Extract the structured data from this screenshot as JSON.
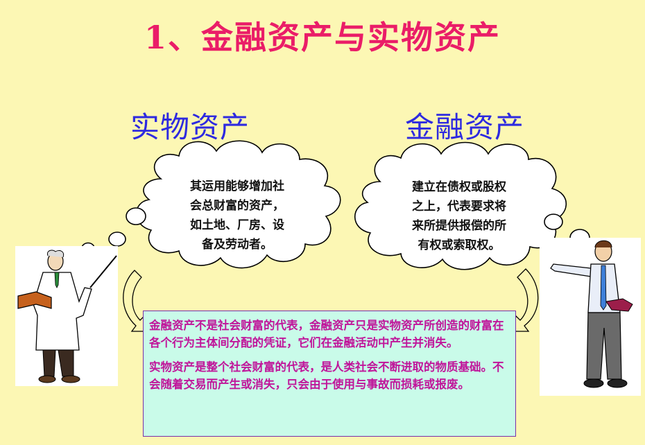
{
  "title": "1、金融资产与实物资产",
  "left_heading": "实物资产",
  "right_heading": "金融资产",
  "left_cloud": {
    "lines": [
      "其运用能够增加社",
      "会总财富的资产，",
      "如土地、厂房、设",
      "备及劳动者。"
    ]
  },
  "right_cloud": {
    "lines": [
      "建立在债权或股权",
      "之上，代表要求将",
      "来所提供报偿的所",
      "有权或索取权。"
    ]
  },
  "info": {
    "paragraph1": "金融资产不是社会财富的代表，金融资产只是实物资产所创造的财富在各个行为主体间分配的凭证，它们在金融活动中产生并消失。",
    "paragraph2": "实物资产是整个社会财富的代表，是人类社会不断进取的物质基础。不会随着交易而产生或消失，只会由于使用与事故而损耗或报废。"
  },
  "colors": {
    "background": "#fcf7b4",
    "title": "#ea1d68",
    "heading": "#2e2ae0",
    "box_fill": "#c9fbe9",
    "box_text": "#c0159a"
  },
  "icons": {
    "left_figure": "professor-pointing-icon",
    "right_figure": "businessman-pointing-icon"
  }
}
